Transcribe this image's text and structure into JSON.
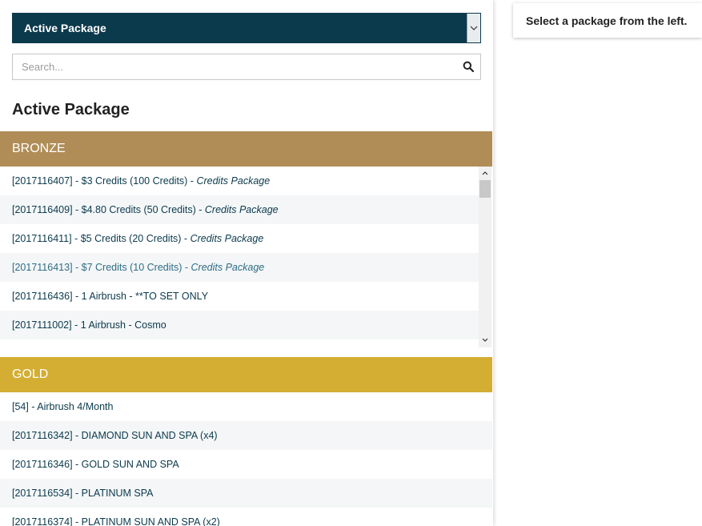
{
  "select": {
    "value": "Active Package"
  },
  "search": {
    "placeholder": "Search..."
  },
  "section_title": "Active Package",
  "groups": {
    "bronze": {
      "name": "BRONZE",
      "color": "#b08d57",
      "items": [
        {
          "label": "[2017116407] - $3 Credits (100 Credits) - ",
          "type": "Credits Package"
        },
        {
          "label": "[2017116409] - $4.80 Credits (50 Credits) - ",
          "type": "Credits Package"
        },
        {
          "label": "[2017116411] - $5 Credits (20 Credits) - ",
          "type": "Credits Package"
        },
        {
          "label": "[2017116413] - $7 Credits (10 Credits) - ",
          "type": "Credits Package"
        },
        {
          "label": "[2017116436] - 1 Airbrush - **TO SET ONLY",
          "type": ""
        },
        {
          "label": "[2017111002] - 1 Airbrush - Cosmo",
          "type": ""
        }
      ]
    },
    "gold": {
      "name": "GOLD",
      "color": "#d4ae33",
      "items": [
        {
          "label": "[54] - Airbrush 4/Month",
          "type": ""
        },
        {
          "label": "[2017116342] - DIAMOND SUN AND SPA (x4)",
          "type": ""
        },
        {
          "label": "[2017116346] - GOLD SUN AND SPA",
          "type": ""
        },
        {
          "label": "[2017116534] - PLATINUM SPA",
          "type": ""
        },
        {
          "label": "[2017116374] - PLATINUM SUN AND SPA (x2)",
          "type": ""
        }
      ]
    }
  },
  "right_panel": {
    "message": "Select a package from the left."
  },
  "colors": {
    "primary": "#0c3a4d",
    "bronze": "#b08d57",
    "gold": "#d4ae33"
  },
  "icons": {
    "select_arrow": "chevron-down-icon",
    "search": "search-icon",
    "scroll_up": "chevron-up-icon",
    "scroll_down": "chevron-down-icon"
  }
}
